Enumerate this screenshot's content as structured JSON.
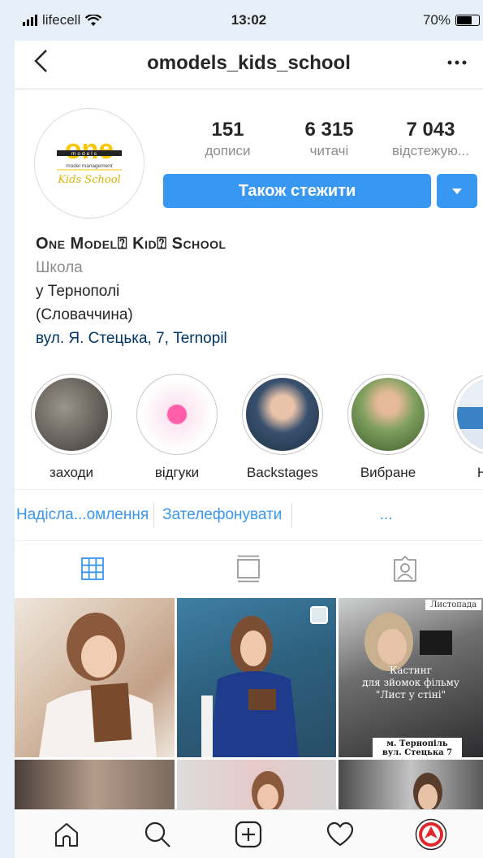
{
  "status_bar": {
    "carrier": "lifecell",
    "time": "13:02",
    "battery": "70%",
    "battery_level": 0.7
  },
  "nav": {
    "back_icon": "chevron-left-icon",
    "title": "omodels_kids_school",
    "more_icon": "more-horizontal-icon"
  },
  "profile": {
    "avatar_logo": {
      "big": "one",
      "small": "models",
      "subtitle": "model management",
      "tagline": "Kids School"
    },
    "stats": [
      {
        "value": "151",
        "label": "дописи"
      },
      {
        "value": "6 315",
        "label": "читачі"
      },
      {
        "value": "7 043",
        "label": "відстежую..."
      }
    ],
    "follow_button": "Також стежити",
    "dropdown_icon": "caret-down-icon"
  },
  "bio": {
    "name": "One Model⍰ Kid⍰ School",
    "category": "Школа",
    "line1": "у Тернополі",
    "line2": "(Словаччина)",
    "address": "вул. Я. Стецька, 7, Ternopil"
  },
  "highlights": [
    {
      "label": "заходи",
      "color": "#5b5650"
    },
    {
      "label": "відгуки",
      "color": "#f3e6ef"
    },
    {
      "label": "Backstages",
      "color": "#39516e"
    },
    {
      "label": "Вибране",
      "color": "#6b8f4f"
    },
    {
      "label": "Нови",
      "color": "#c9d8e8"
    }
  ],
  "contacts": {
    "send": "Надісла...омлення",
    "call": "Зателефонувати",
    "more": "..."
  },
  "tabs": [
    {
      "name": "grid",
      "icon": "grid-icon",
      "active": true
    },
    {
      "name": "feed",
      "icon": "feed-icon",
      "active": false
    },
    {
      "name": "tagged",
      "icon": "tagged-icon",
      "active": false
    }
  ],
  "posts": {
    "poster": {
      "top_tag": "Листопада",
      "line1": "Кастинг",
      "line2": "для зйомок фільму",
      "line3": "\"Лист у стіні\"",
      "bottom_line1": "м. Тернопіль",
      "bottom_line2": "вул. Стецька 7"
    }
  },
  "tabbar": [
    {
      "name": "home",
      "icon": "home-icon"
    },
    {
      "name": "search",
      "icon": "search-icon"
    },
    {
      "name": "new-post",
      "icon": "plus-square-icon"
    },
    {
      "name": "activity",
      "icon": "heart-icon"
    },
    {
      "name": "profile",
      "icon": "profile-avatar-icon"
    }
  ],
  "colors": {
    "accent": "#3897f0",
    "link": "#003569",
    "muted": "#8e8e8e"
  }
}
